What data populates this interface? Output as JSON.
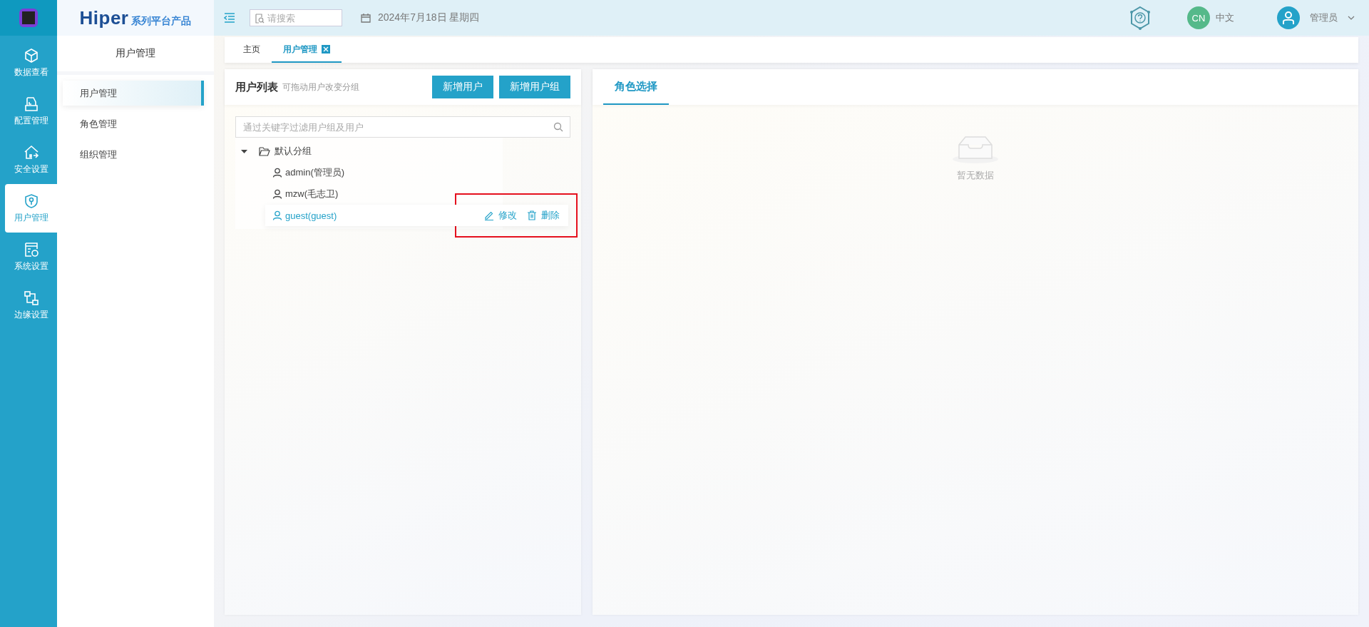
{
  "logo": {
    "brand": "Hiper",
    "tagline": "系列平台产品"
  },
  "rail": [
    {
      "label": "数据查看",
      "kind": "cube",
      "selected": false
    },
    {
      "label": "配置管理",
      "kind": "config",
      "selected": false
    },
    {
      "label": "安全设置",
      "kind": "security",
      "selected": false
    },
    {
      "label": "用户管理",
      "kind": "shield",
      "selected": true
    },
    {
      "label": "系统设置",
      "kind": "system",
      "selected": false
    },
    {
      "label": "边缘设置",
      "kind": "edge",
      "selected": false
    }
  ],
  "sidebar": {
    "title": "用户管理",
    "items": [
      {
        "label": "用户管理",
        "selected": true
      },
      {
        "label": "角色管理",
        "selected": false
      },
      {
        "label": "组织管理",
        "selected": false
      }
    ]
  },
  "topbar": {
    "search": {
      "placeholder": "请搜索"
    },
    "date": "2024年7月18日 星期四",
    "lang_badge": "CN",
    "lang": "中文",
    "user": "管理员"
  },
  "tabs": [
    {
      "label": "主页",
      "selected": false,
      "closable": false
    },
    {
      "label": "用户管理",
      "selected": true,
      "closable": true
    }
  ],
  "user_panel": {
    "title": "用户列表",
    "hint": "可拖动用户改变分组",
    "buttons": [
      "新增用户",
      "新增用户组"
    ],
    "filter": {
      "placeholder": "通过关键字过滤用户组及用户"
    },
    "tree": [
      {
        "label": "默认分组",
        "expanded": true,
        "children": [
          {
            "label": "admin(管理员)",
            "selected": false,
            "highlighted": false
          },
          {
            "label": "mzw(毛志卫)",
            "selected": false,
            "highlighted": false
          },
          {
            "label": "guest(guest)",
            "selected": true,
            "highlighted": true
          }
        ]
      }
    ],
    "row_actions": [
      {
        "kind": "edit",
        "label": "修改"
      },
      {
        "kind": "delete",
        "label": "删除"
      }
    ]
  },
  "role_panel": {
    "tab": "角色选择",
    "empty": "暂无数据"
  }
}
